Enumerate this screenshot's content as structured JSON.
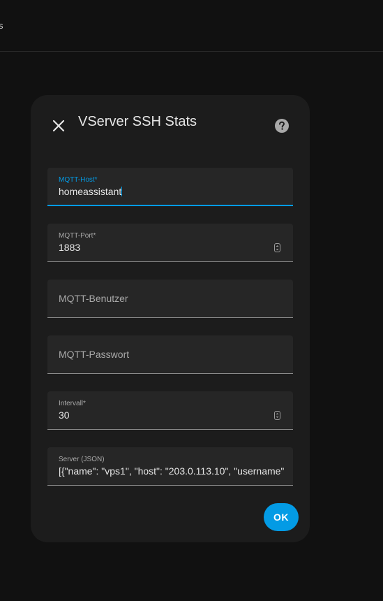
{
  "topbar": {
    "fragment": "s"
  },
  "dialog": {
    "title": "VServer SSH Stats",
    "close_icon": "close-icon",
    "help_icon": "help-circle-icon",
    "ok_label": "OK",
    "accent_color": "#039be5",
    "fields": {
      "mqtt_host": {
        "label": "MQTT-Host*",
        "value": "homeassistant"
      },
      "mqtt_port": {
        "label": "MQTT-Port*",
        "value": "1883"
      },
      "mqtt_user": {
        "label": "MQTT-Benutzer"
      },
      "mqtt_password": {
        "label": "MQTT-Passwort"
      },
      "interval": {
        "label": "Intervall*",
        "value": "30"
      },
      "servers": {
        "label": "Server (JSON)",
        "value": "[{\"name\": \"vps1\", \"host\": \"203.0.113.10\", \"username\""
      }
    }
  }
}
